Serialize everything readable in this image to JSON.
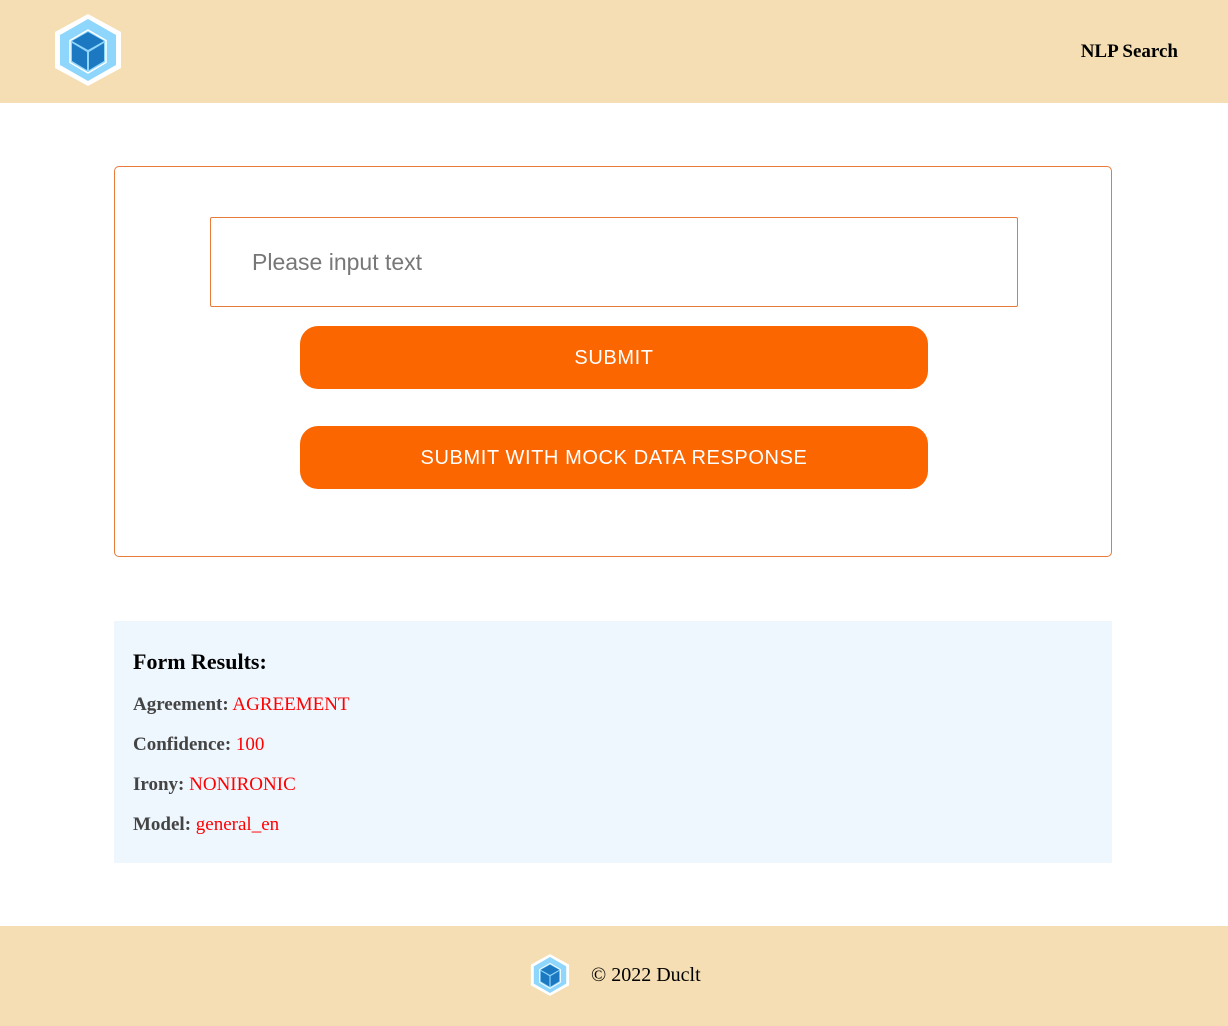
{
  "header": {
    "logo_icon": "cube-logo-icon",
    "nav_link": "NLP Search"
  },
  "form": {
    "input_placeholder": "Please input text",
    "input_value": "",
    "submit_label": "SUBMIT",
    "mock_label": "SUBMIT WITH MOCK DATA RESPONSE"
  },
  "results": {
    "title": "Form Results:",
    "agreement_label": "Agreement:",
    "agreement_value": "AGREEMENT",
    "confidence_label": "Confidence:",
    "confidence_value": "100",
    "irony_label": "Irony:",
    "irony_value": "NONIRONIC",
    "model_label": "Model:",
    "model_value": "general_en"
  },
  "footer": {
    "logo_icon": "cube-logo-icon",
    "copyright": "© 2022 Duclt"
  },
  "colors": {
    "header_bg": "#f5deb3",
    "accent": "#fb6600",
    "border": "#e87a3c",
    "results_bg": "#eef6fe",
    "value_text": "#ff0000"
  }
}
